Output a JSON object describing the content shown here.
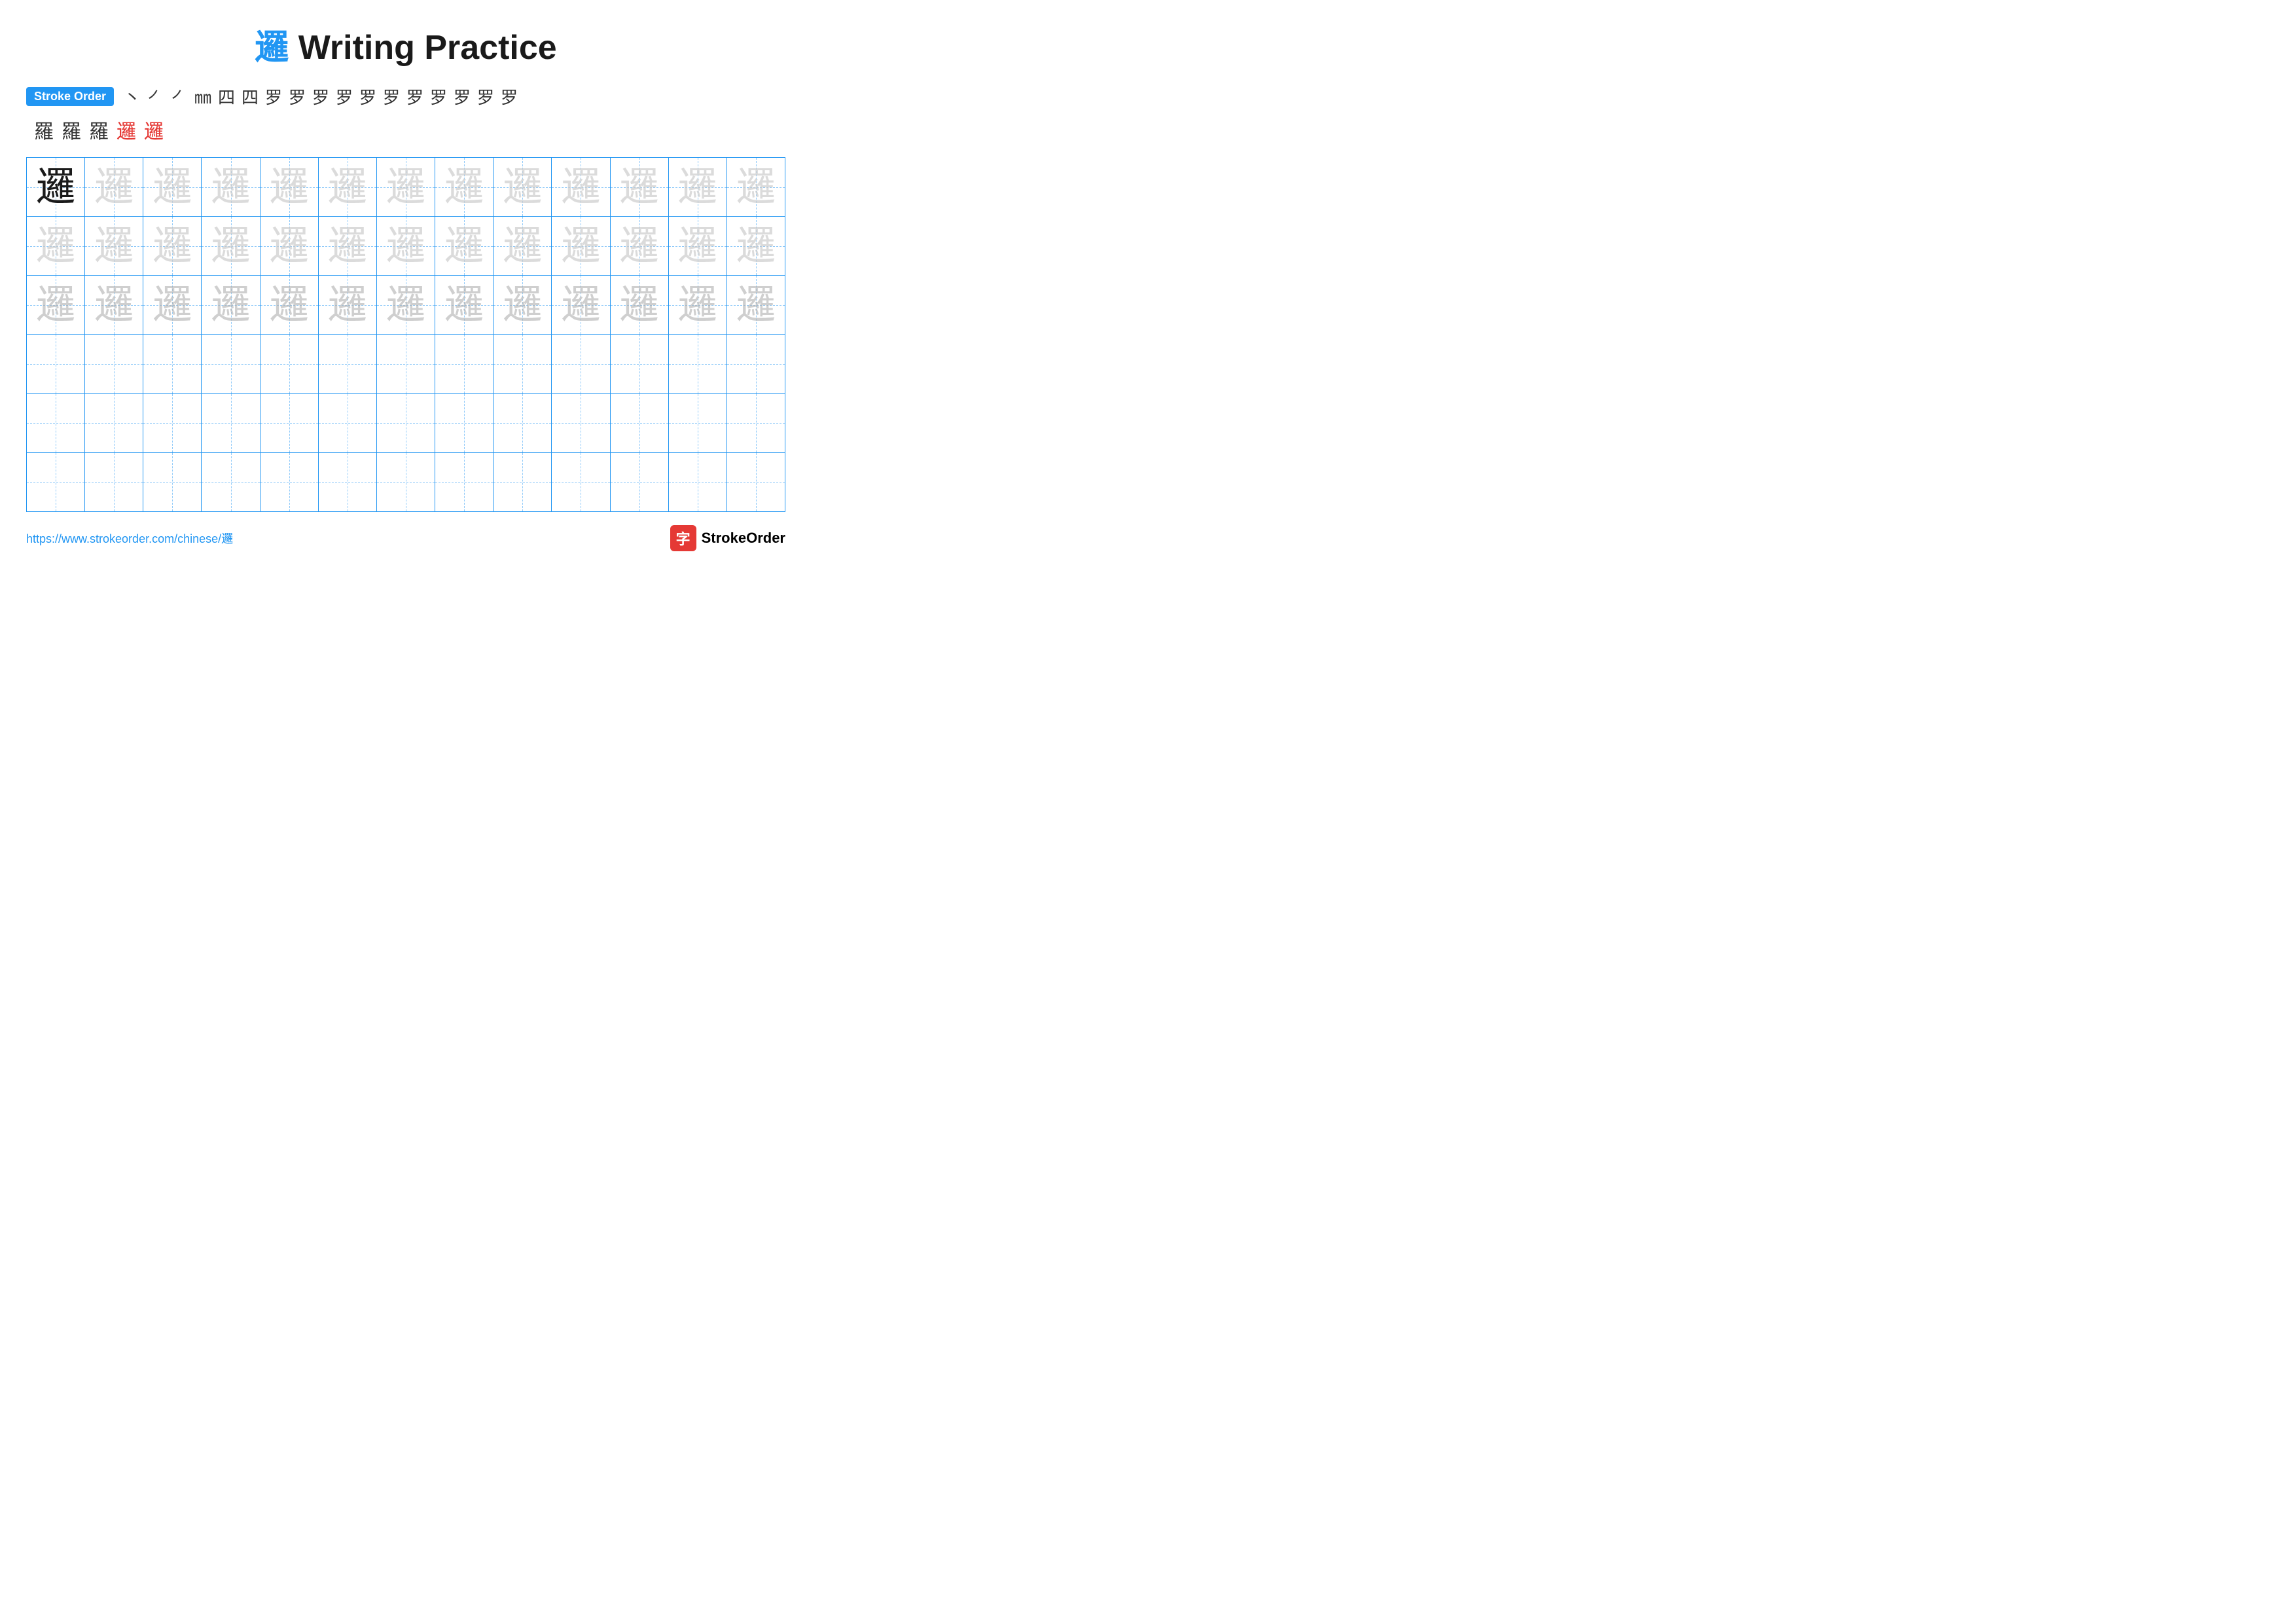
{
  "title": {
    "char": "邏",
    "text": " Writing Practice"
  },
  "stroke_order": {
    "badge": "Stroke Order",
    "strokes_row1": [
      "丶",
      "㇒",
      "㇒",
      "㎜",
      "四",
      "四",
      "罗",
      "罗",
      "罗",
      "罗",
      "罗",
      "罗",
      "罗",
      "罗",
      "罗",
      "罗",
      "罗"
    ],
    "strokes_row2": [
      "羅",
      "羅",
      "羅",
      "邏",
      "邏"
    ]
  },
  "grid": {
    "rows": 6,
    "cols": 13,
    "char": "邏",
    "filled_rows": 3,
    "first_cell_dark": true
  },
  "footer": {
    "url": "https://www.strokeorder.com/chinese/邏",
    "logo_text": "StrokeOrder",
    "logo_icon": "字"
  }
}
